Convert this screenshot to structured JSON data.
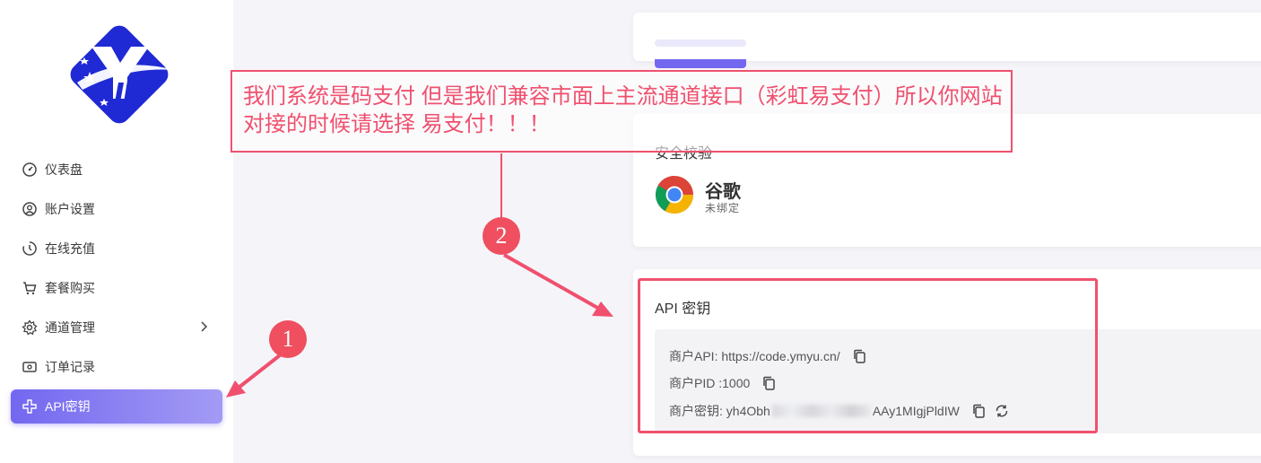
{
  "sidebar": {
    "items": [
      {
        "label": "仪表盘",
        "icon": "dashboard-icon"
      },
      {
        "label": "账户设置",
        "icon": "account-icon"
      },
      {
        "label": "在线充值",
        "icon": "recharge-icon"
      },
      {
        "label": "套餐购买",
        "icon": "cart-icon"
      },
      {
        "label": "通道管理",
        "icon": "gear-icon"
      },
      {
        "label": "订单记录",
        "icon": "order-icon"
      },
      {
        "label": "API密钥",
        "icon": "api-icon"
      }
    ]
  },
  "security": {
    "title": "安全校验",
    "google_name": "谷歌",
    "google_status": "未绑定"
  },
  "api": {
    "title": "API 密钥",
    "merchant_api": "商户API: https://code.ymyu.cn/",
    "merchant_pid": "商户PID :1000",
    "key_prefix": "商户密钥: yh4Obh",
    "key_suffix": "AAy1MIgjPldIW"
  },
  "annotation": {
    "text": "我们系统是码支付 但是我们兼容市面上主流通道接口（彩虹易支付）所以你网站 对接的时候请选择 易支付！！！",
    "marker1": "1",
    "marker2": "2"
  },
  "colors": {
    "accent": "#7367f0",
    "annotation": "#f0506e"
  }
}
